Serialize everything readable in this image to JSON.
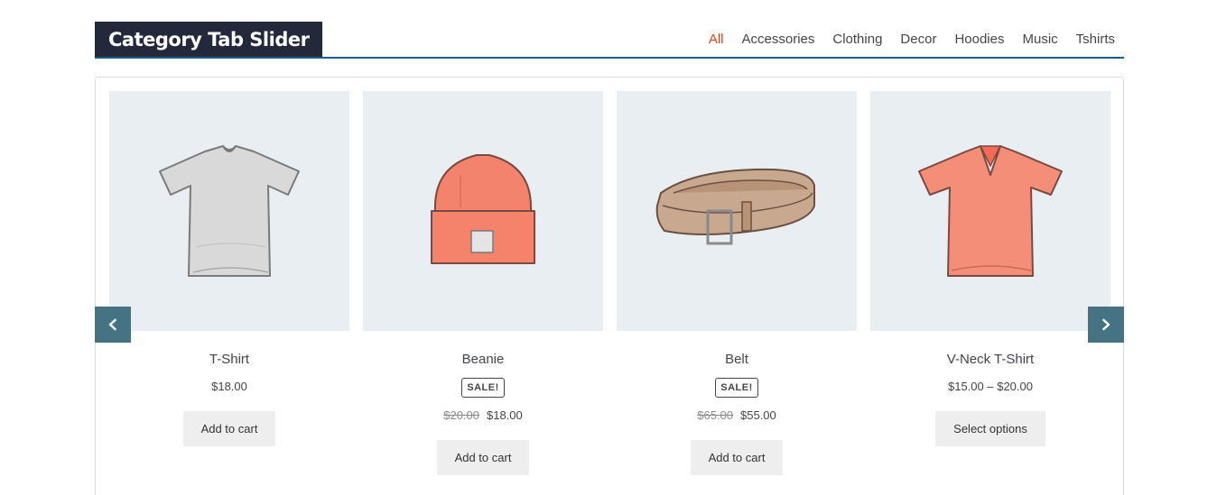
{
  "header": {
    "title": "Category Tab Slider",
    "tabs": [
      {
        "label": "All",
        "active": true
      },
      {
        "label": "Accessories",
        "active": false
      },
      {
        "label": "Clothing",
        "active": false
      },
      {
        "label": "Decor",
        "active": false
      },
      {
        "label": "Hoodies",
        "active": false
      },
      {
        "label": "Music",
        "active": false
      },
      {
        "label": "Tshirts",
        "active": false
      }
    ]
  },
  "products": [
    {
      "name": "T-Shirt",
      "image": "tshirt-grey",
      "sale_badge": "",
      "old_price": "",
      "price": "$18.00",
      "button": "Add to cart"
    },
    {
      "name": "Beanie",
      "image": "beanie-coral",
      "sale_badge": "SALE!",
      "old_price": "$20.00",
      "price": "$18.00",
      "button": "Add to cart"
    },
    {
      "name": "Belt",
      "image": "belt-tan",
      "sale_badge": "SALE!",
      "old_price": "$65.00",
      "price": "$55.00",
      "button": "Add to cart"
    },
    {
      "name": "V-Neck T-Shirt",
      "image": "vneck-tshirt-coral",
      "sale_badge": "",
      "old_price": "",
      "price": "$15.00 – $20.00",
      "button": "Select options"
    }
  ],
  "nav": {
    "prev_icon": "chevron-left-icon",
    "next_icon": "chevron-right-icon"
  },
  "colors": {
    "title_bg": "#23293a",
    "accent": "#e2401c",
    "rule": "#1e5a8a",
    "nav_bg": "#467383",
    "image_bg": "#e9eef2"
  }
}
